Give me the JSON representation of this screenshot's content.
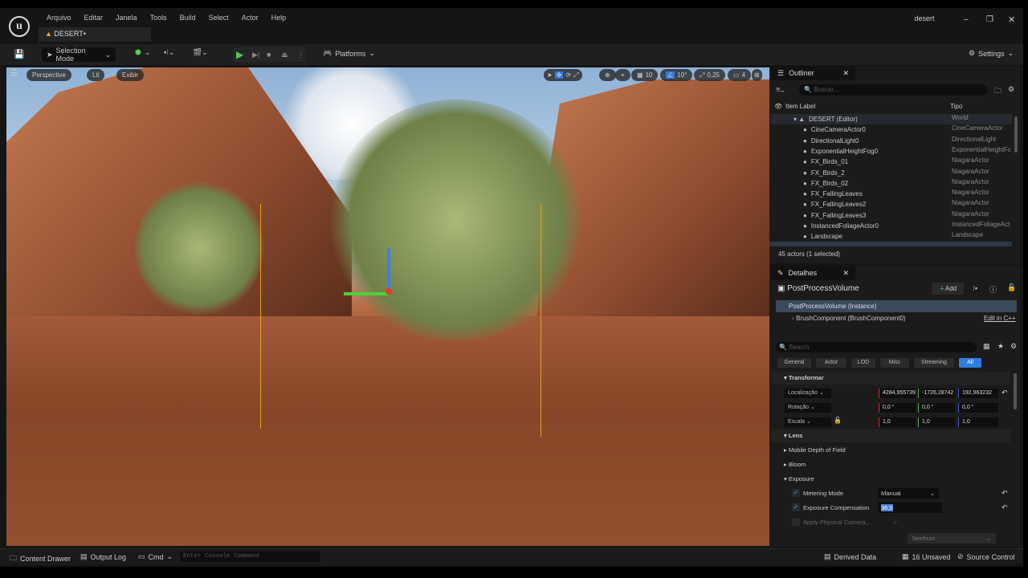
{
  "menu": [
    "Arquivo",
    "Editar",
    "Janela",
    "Tools",
    "Build",
    "Select",
    "Actor",
    "Help"
  ],
  "project_name": "desert",
  "level_tab": "DESERT•",
  "toolbar": {
    "selection_mode": "Selection Mode",
    "platforms": "Platforms",
    "settings": "Settings"
  },
  "viewport": {
    "perspective": "Perspective",
    "lit": "Lit",
    "show": "Exibir",
    "grid_snap": "10",
    "rotation_snap": "10°",
    "scale_snap": "0,25",
    "camera_speed": "4"
  },
  "outliner": {
    "title": "Outliner",
    "search_placeholder": "Buscar...",
    "col_label": "Item Label",
    "col_type": "Tipo",
    "items": [
      {
        "label": "DESERT (Editor)",
        "type": "World"
      },
      {
        "label": "CineCameraActor0",
        "type": "CineCameraActor"
      },
      {
        "label": "DirectionalLight0",
        "type": "DirectionalLight"
      },
      {
        "label": "ExponentialHeightFog0",
        "type": "ExponentialHeightFc"
      },
      {
        "label": "FX_Birds_01",
        "type": "NiagaraActor"
      },
      {
        "label": "FX_Birds_2",
        "type": "NiagaraActor"
      },
      {
        "label": "FX_Birds_02",
        "type": "NiagaraActor"
      },
      {
        "label": "FX_FallingLeaves",
        "type": "NiagaraActor"
      },
      {
        "label": "FX_FallingLeaves2",
        "type": "NiagaraActor"
      },
      {
        "label": "FX_FallingLeaves3",
        "type": "NiagaraActor"
      },
      {
        "label": "InstancedFoliageActor0",
        "type": "InstancedFoliageAct"
      },
      {
        "label": "Landscape",
        "type": "Landscape"
      }
    ],
    "footer": "45 actors (1 selected)"
  },
  "details": {
    "title": "Detalhes",
    "actor": "PostProcessVolume",
    "add": "Add",
    "instance": "PostProcessVolume (Instance)",
    "component": "BrushComponent (BrushComponent0)",
    "edit_cpp": "Edit in C++",
    "search_placeholder": "Search",
    "filters": [
      "General",
      "Actor",
      "LOD",
      "Misc",
      "Streaming",
      "All"
    ],
    "transform_header": "Transformar",
    "location": {
      "label": "Localização",
      "x": "4284,955739",
      "y": "-1726,28742",
      "z": "192,963232"
    },
    "rotation": {
      "label": "Rotação",
      "x": "0,0 °",
      "y": "0,0 °",
      "z": "0,0 °"
    },
    "scale": {
      "label": "Escala",
      "x": "1,0",
      "y": "1,0",
      "z": "1,0"
    },
    "lens": "Lens",
    "mobile_dof": "Mobile Depth of Field",
    "bloom": "Bloom",
    "exposure": "Exposure",
    "metering_mode": {
      "label": "Metering Mode",
      "value": "Manual"
    },
    "exposure_comp": {
      "label": "Exposure Compensation",
      "value": "36,0"
    },
    "apply_physical": "Apply Physical Camera...",
    "none_option": "Nenhum"
  },
  "status": {
    "content_drawer": "Content Drawer",
    "output_log": "Output Log",
    "cmd": "Cmd",
    "console_placeholder": "Enter Console Command",
    "derived_data": "Derived Data",
    "unsaved": "16 Unsaved",
    "source_control": "Source Control"
  }
}
